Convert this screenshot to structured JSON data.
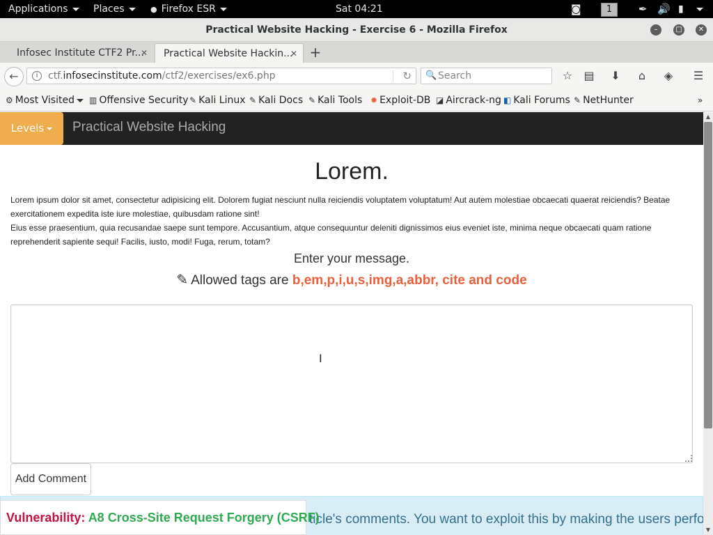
{
  "topbar": {
    "applications": "Applications",
    "places": "Places",
    "browser": "Firefox ESR",
    "clock": "Sat 04:21",
    "workspace": "1"
  },
  "window": {
    "title": "Practical Website Hacking - Exercise 6 - Mozilla Firefox"
  },
  "tabs": [
    {
      "label": "Infosec Institute CTF2 Pr..."
    },
    {
      "label": "Practical Website Hackin..."
    }
  ],
  "nav": {
    "url_prefix": "ctf.",
    "url_host": "infosecinstitute.com",
    "url_path": "/ctf2/exercises/ex6.php",
    "search_placeholder": "Search"
  },
  "bookmarks": [
    {
      "label": "Most Visited",
      "icon": "gear-icon"
    },
    {
      "label": "Offensive Security",
      "icon": "offsec-icon"
    },
    {
      "label": "Kali Linux",
      "icon": "kali-icon"
    },
    {
      "label": "Kali Docs",
      "icon": "kali-icon"
    },
    {
      "label": "Kali Tools",
      "icon": "kali-icon"
    },
    {
      "label": "Exploit-DB",
      "icon": "exploitdb-icon"
    },
    {
      "label": "Aircrack-ng",
      "icon": "aircrack-icon"
    },
    {
      "label": "Kali Forums",
      "icon": "kali-forums-icon"
    },
    {
      "label": "NetHunter",
      "icon": "kali-icon"
    }
  ],
  "site": {
    "levels_label": "Levels",
    "brand": "Practical Website Hacking",
    "heading": "Lorem.",
    "paragraph1": "Lorem ipsum dolor sit amet, consectetur adipisicing elit. Dolorem fugiat nesciunt nulla reiciendis voluptatem voluptatum! Aut autem molestiae obcaecati quaerat reiciendis? Beatae exercitationem expedita iste iure molestiae, quibusdam ratione sint!",
    "paragraph2": "Eius esse praesentium, quia recusandae saepe sunt tempore. Accusantium, atque consequuntur deleniti dignissimos eius eveniet iste, minima neque obcaecati quam ratione reprehenderit sapiente sequi! Facilis, iusto, modi! Fuga, rerum, totam?",
    "prompt": "Enter your message.",
    "allowed_prefix": "Allowed tags are ",
    "allowed_tags": "b,em,p,i,u,s,img,a,abbr, cite and code",
    "comment_value": "",
    "add_comment": "Add Comment",
    "info_text": "ticle's comments. You want to exploit this by making the users perform an action",
    "vuln_label": "Vulnerability: ",
    "vuln_value": "A8 Cross-Site Request Forgery (CSRF)"
  },
  "colors": {
    "levels_bg": "#f0ad4e",
    "tags_color": "#e8603c",
    "vuln_label_color": "#c0133f",
    "vuln_value_color": "#2eaa4f",
    "info_bg": "#d9edf7"
  }
}
